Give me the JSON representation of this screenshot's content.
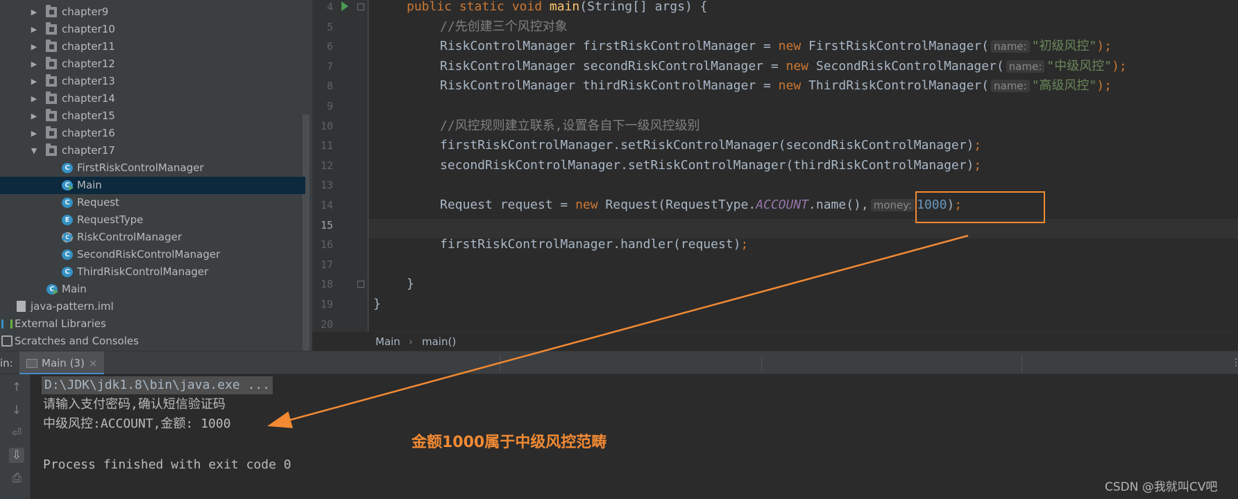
{
  "project_tree": {
    "items": [
      {
        "label": "chapter9",
        "kind": "folder",
        "expanded": false
      },
      {
        "label": "chapter10",
        "kind": "folder",
        "expanded": false
      },
      {
        "label": "chapter11",
        "kind": "folder",
        "expanded": false
      },
      {
        "label": "chapter12",
        "kind": "folder",
        "expanded": false
      },
      {
        "label": "chapter13",
        "kind": "folder",
        "expanded": false
      },
      {
        "label": "chapter14",
        "kind": "folder",
        "expanded": false
      },
      {
        "label": "chapter15",
        "kind": "folder",
        "expanded": false
      },
      {
        "label": "chapter16",
        "kind": "folder",
        "expanded": false
      },
      {
        "label": "chapter17",
        "kind": "folder",
        "expanded": true
      },
      {
        "label": "FirstRiskControlManager",
        "kind": "class"
      },
      {
        "label": "Main",
        "kind": "class-main",
        "selected": true
      },
      {
        "label": "Request",
        "kind": "class"
      },
      {
        "label": "RequestType",
        "kind": "enum"
      },
      {
        "label": "RiskControlManager",
        "kind": "abstract-class"
      },
      {
        "label": "SecondRiskControlManager",
        "kind": "class"
      },
      {
        "label": "ThirdRiskControlManager",
        "kind": "class"
      },
      {
        "label": "Main",
        "kind": "class-main"
      },
      {
        "label": "java-pattern.iml",
        "kind": "iml"
      },
      {
        "label": "External Libraries",
        "kind": "libraries"
      },
      {
        "label": "Scratches and Consoles",
        "kind": "scratches"
      }
    ]
  },
  "editor": {
    "line_numbers": [
      "4",
      "5",
      "6",
      "7",
      "8",
      "9",
      "10",
      "11",
      "12",
      "13",
      "14",
      "15",
      "16",
      "17",
      "18",
      "19",
      "20"
    ],
    "current_line": "15",
    "code": {
      "l4_kw": "public static void ",
      "l4_fn": "main",
      "l4_rest": "(String[] args) {",
      "l5": "//先创建三个风控对象",
      "l6_a": "RiskControlManager firstRiskControlManager = ",
      "l6_new": "new",
      "l6_b": " FirstRiskControlManager(",
      "l6_hint": "name:",
      "l6_str": "\"初级风控\"",
      "l6_end": ");",
      "l7_a": "RiskControlManager secondRiskControlManager = ",
      "l7_new": "new",
      "l7_b": " SecondRiskControlManager(",
      "l7_hint": "name:",
      "l7_str": "\"中级风控\"",
      "l7_end": ");",
      "l8_a": "RiskControlManager thirdRiskControlManager = ",
      "l8_new": "new",
      "l8_b": " ThirdRiskControlManager(",
      "l8_hint": "name:",
      "l8_str": "\"高级风控\"",
      "l8_end": ");",
      "l10": "//风控规则建立联系,设置各自下一级风控级别",
      "l11_a": "firstRiskControlManager.setRiskControlManager(secondRiskControlManager)",
      "l11_end": ";",
      "l12_a": "secondRiskControlManager.setRiskControlManager(thirdRiskControlManager)",
      "l12_end": ";",
      "l14_a": "Request request = ",
      "l14_new": "new",
      "l14_b": " Request(RequestType.",
      "l14_enum": "ACCOUNT",
      "l14_c": ".name(),",
      "l14_hint": "money:",
      "l14_num": "1000",
      "l14_d": ")",
      "l14_end": ";",
      "l16_a": "firstRiskControlManager.handler(request)",
      "l16_end": ";",
      "l18": "}",
      "l19": "}"
    }
  },
  "breadcrumb": {
    "class": "Main",
    "sep": "›",
    "method": "main()"
  },
  "run_panel": {
    "label": "in:",
    "tab_label": "Main (3)",
    "tab_close": "×",
    "toolbar": [
      "↑",
      "↓",
      "⏎",
      "⇩",
      "⎙"
    ],
    "console": [
      "D:\\JDK\\jdk1.8\\bin\\java.exe ...",
      "请输入支付密码,确认短信验证码",
      "中级风控:ACCOUNT,金额: 1000",
      "",
      "Process finished with exit code 0"
    ]
  },
  "annotation": {
    "text": "金额1000属于中级风控范畴",
    "color": "#f28a33"
  },
  "watermark": "CSDN @我就叫CV吧"
}
